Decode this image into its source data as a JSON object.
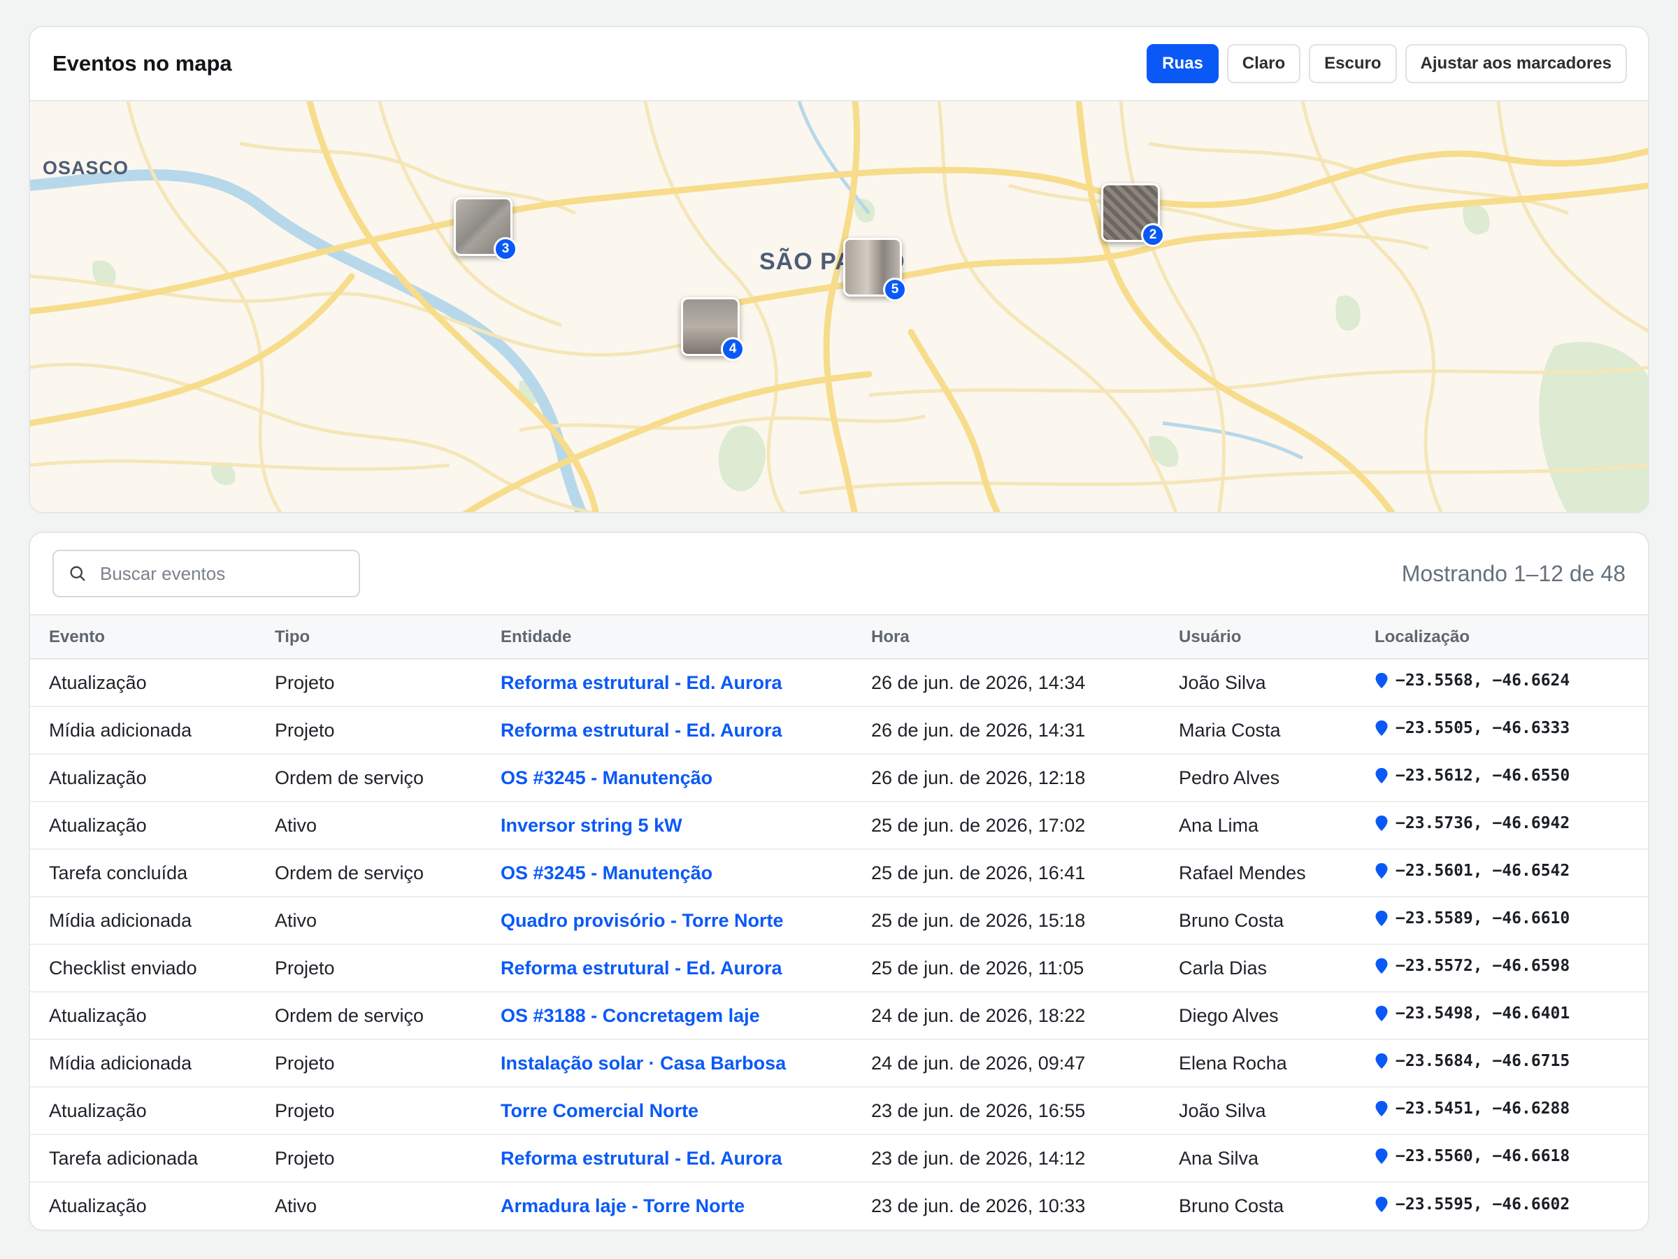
{
  "map": {
    "title": "Eventos no mapa",
    "buttons": [
      {
        "label": "Ruas",
        "active": true
      },
      {
        "label": "Claro",
        "active": false
      },
      {
        "label": "Escuro",
        "active": false
      },
      {
        "label": "Ajustar aos marcadores",
        "active": false
      }
    ],
    "labels": {
      "city_osasco": "OSASCO",
      "city_sp": "SÃO PAULO"
    },
    "markers": [
      {
        "count": "3",
        "icon": "photo-crack-wall"
      },
      {
        "count": "4",
        "icon": "photo-rubble-floor"
      },
      {
        "count": "5",
        "icon": "photo-electrical-panel"
      },
      {
        "count": "2",
        "icon": "photo-rebar-slab"
      }
    ]
  },
  "events": {
    "search_placeholder": "Buscar eventos",
    "count_text": "Mostrando 1–12 de 48",
    "columns": [
      "Evento",
      "Tipo",
      "Entidade",
      "Hora",
      "Usuário",
      "Localização"
    ],
    "rows": [
      {
        "evento": "Atualização",
        "tipo": "Projeto",
        "entidade": "Reforma estrutural - Ed. Aurora",
        "hora": "26 de jun. de 2026, 14:34",
        "usuario": "João Silva",
        "loc": "−23.5568, −46.6624"
      },
      {
        "evento": "Mídia adicionada",
        "tipo": "Projeto",
        "entidade": "Reforma estrutural - Ed. Aurora",
        "hora": "26 de jun. de 2026, 14:31",
        "usuario": "Maria Costa",
        "loc": "−23.5505, −46.6333"
      },
      {
        "evento": "Atualização",
        "tipo": "Ordem de serviço",
        "entidade": "OS #3245 - Manutenção",
        "hora": "26 de jun. de 2026, 12:18",
        "usuario": "Pedro Alves",
        "loc": "−23.5612, −46.6550"
      },
      {
        "evento": "Atualização",
        "tipo": "Ativo",
        "entidade": "Inversor string 5 kW",
        "hora": "25 de jun. de 2026, 17:02",
        "usuario": "Ana Lima",
        "loc": "−23.5736, −46.6942"
      },
      {
        "evento": "Tarefa concluída",
        "tipo": "Ordem de serviço",
        "entidade": "OS #3245 - Manutenção",
        "hora": "25 de jun. de 2026, 16:41",
        "usuario": "Rafael Mendes",
        "loc": "−23.5601, −46.6542"
      },
      {
        "evento": "Mídia adicionada",
        "tipo": "Ativo",
        "entidade": "Quadro provisório - Torre Norte",
        "hora": "25 de jun. de 2026, 15:18",
        "usuario": "Bruno Costa",
        "loc": "−23.5589, −46.6610"
      },
      {
        "evento": "Checklist enviado",
        "tipo": "Projeto",
        "entidade": "Reforma estrutural - Ed. Aurora",
        "hora": "25 de jun. de 2026, 11:05",
        "usuario": "Carla Dias",
        "loc": "−23.5572, −46.6598"
      },
      {
        "evento": "Atualização",
        "tipo": "Ordem de serviço",
        "entidade": "OS #3188 - Concretagem laje",
        "hora": "24 de jun. de 2026, 18:22",
        "usuario": "Diego Alves",
        "loc": "−23.5498, −46.6401"
      },
      {
        "evento": "Mídia adicionada",
        "tipo": "Projeto",
        "entidade": "Instalação solar · Casa Barbosa",
        "hora": "24 de jun. de 2026, 09:47",
        "usuario": "Elena Rocha",
        "loc": "−23.5684, −46.6715"
      },
      {
        "evento": "Atualização",
        "tipo": "Projeto",
        "entidade": "Torre Comercial Norte",
        "hora": "23 de jun. de 2026, 16:55",
        "usuario": "João Silva",
        "loc": "−23.5451, −46.6288"
      },
      {
        "evento": "Tarefa adicionada",
        "tipo": "Projeto",
        "entidade": "Reforma estrutural - Ed. Aurora",
        "hora": "23 de jun. de 2026, 14:12",
        "usuario": "Ana Silva",
        "loc": "−23.5560, −46.6618"
      },
      {
        "evento": "Atualização",
        "tipo": "Ativo",
        "entidade": "Armadura laje - Torre Norte",
        "hora": "23 de jun. de 2026, 10:33",
        "usuario": "Bruno Costa",
        "loc": "−23.5595, −46.6602"
      }
    ]
  },
  "colors": {
    "accent": "#0a59f7",
    "road": "#f7dc8c",
    "map_bg": "#fbf7ee",
    "park": "#dcebd2",
    "water": "#b7d8ea"
  }
}
